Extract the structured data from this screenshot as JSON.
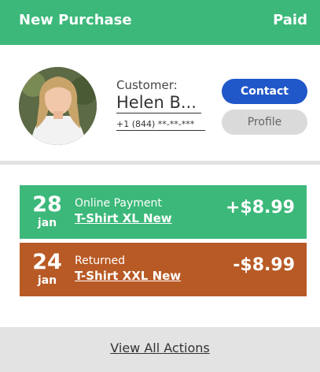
{
  "header": {
    "title": "New Purchase",
    "status": "Paid"
  },
  "customer": {
    "label": "Customer:",
    "name": "Helen B...",
    "phone": "+1 (844) **-**-***",
    "contact_label": "Contact",
    "profile_label": "Profile"
  },
  "transactions": [
    {
      "day": "28",
      "month": "jan",
      "kind": "Online Payment",
      "item": "T-Shirt XL New",
      "amount": "+$8.99"
    },
    {
      "day": "24",
      "month": "jan",
      "kind": "Returned",
      "item": "T-Shirt XXL New",
      "amount": "-$8.99"
    }
  ],
  "footer": {
    "link_label": "View All Actions"
  },
  "colors": {
    "primary": "#3cb87a",
    "returned": "#b85a25",
    "contact": "#2158c9",
    "profile": "#dadada"
  }
}
